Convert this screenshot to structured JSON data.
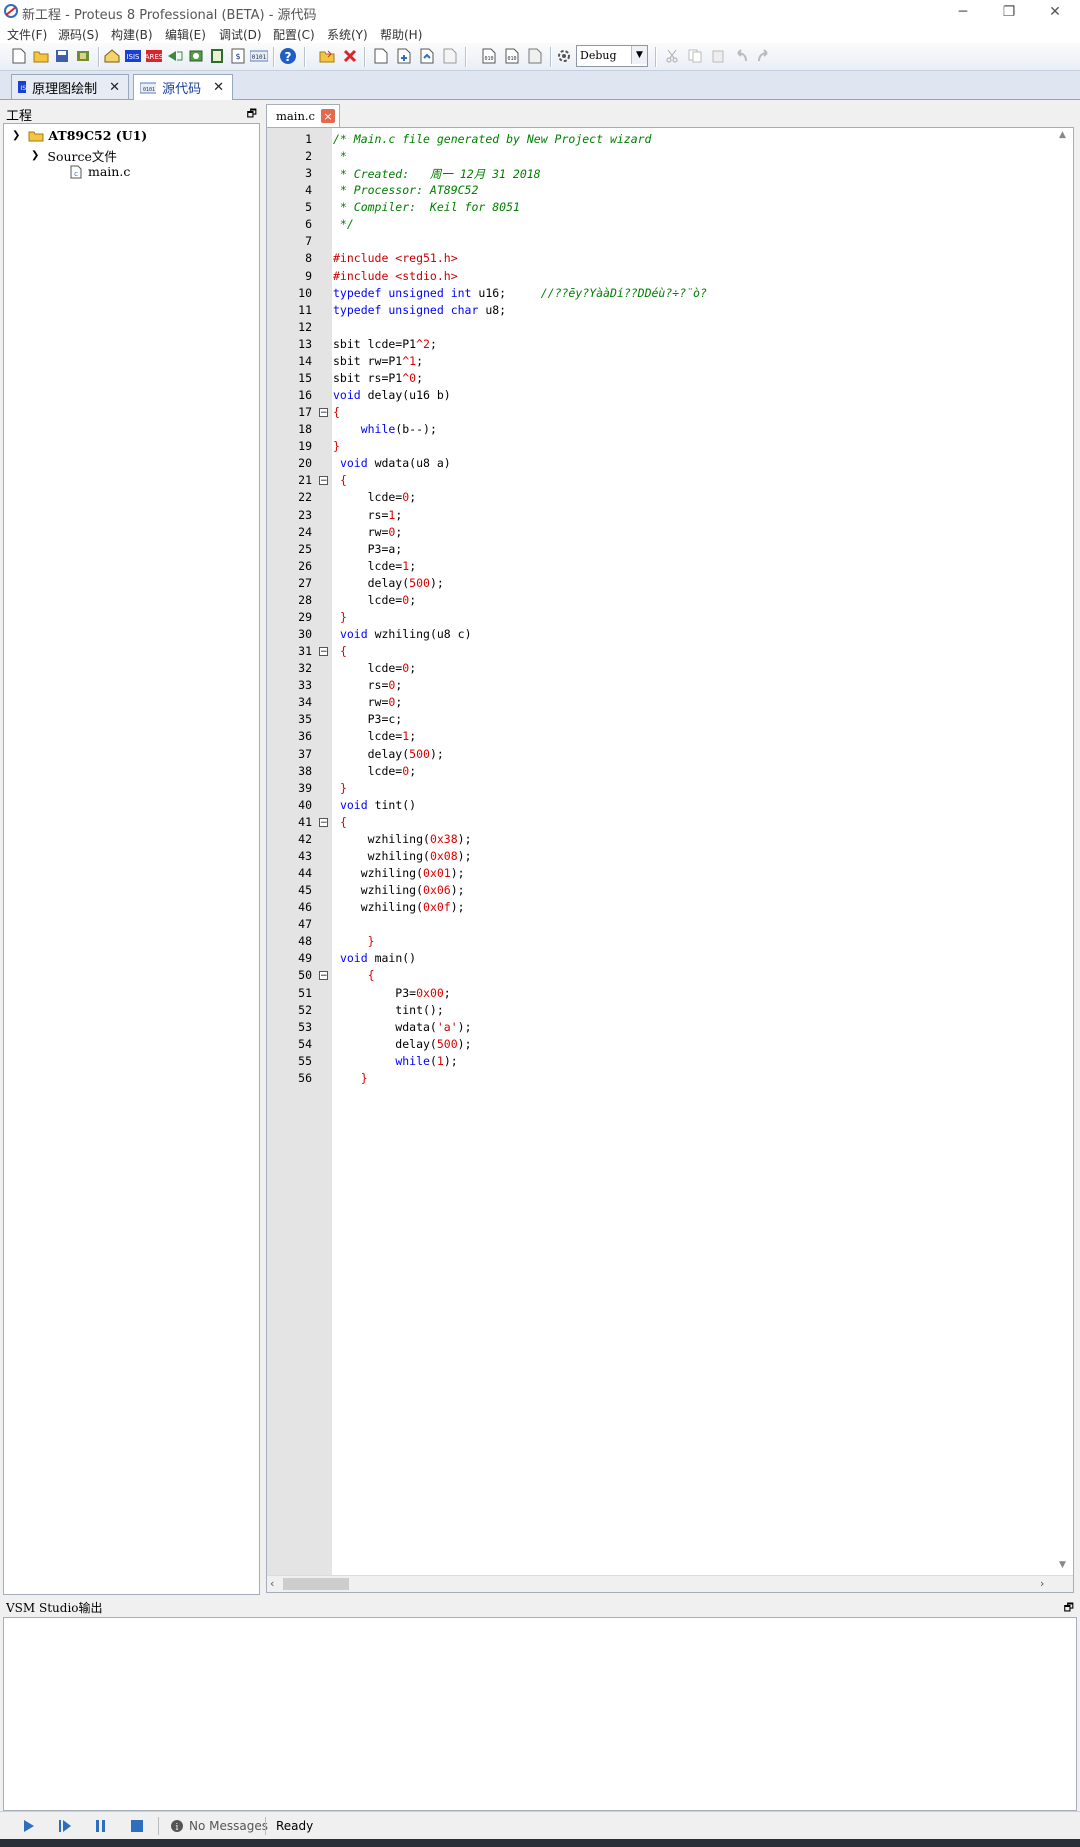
{
  "window": {
    "title": "新工程 - Proteus 8 Professional (BETA) - 源代码",
    "minimize": "─",
    "restore": "❐",
    "close": "✕"
  },
  "menu": [
    "文件(F)",
    "源码(S)",
    "构建(B)",
    "编辑(E)",
    "调试(D)",
    "配置(C)",
    "系统(Y)",
    "帮助(H)"
  ],
  "toolbar": {
    "build_config": "Debug"
  },
  "doc_tabs": [
    {
      "label": "原理图绘制",
      "icon": "schematic-icon",
      "close": "✕"
    },
    {
      "label": "源代码",
      "icon": "source-code-icon",
      "close": "✕"
    }
  ],
  "project": {
    "header": "工程",
    "pin": "🗗",
    "tree": {
      "root": "AT89C52 (U1)",
      "folder": "Source文件",
      "file": "main.c"
    }
  },
  "editor": {
    "tab_label": "main.c",
    "tab_close": "×",
    "lines": [
      [
        [
          "c",
          "/* Main.c file generated by New Project wizard"
        ]
      ],
      [
        [
          "c",
          " *"
        ]
      ],
      [
        [
          "c",
          " * Created:   周一 12月 31 2018"
        ]
      ],
      [
        [
          "c",
          " * Processor: AT89C52"
        ]
      ],
      [
        [
          "c",
          " * Compiler:  Keil for 8051"
        ]
      ],
      [
        [
          "c",
          " */"
        ]
      ],
      [],
      [
        [
          "p",
          "#include <reg51.h>"
        ]
      ],
      [
        [
          "p",
          "#include <stdio.h>"
        ]
      ],
      [
        [
          "k",
          "typedef unsigned int"
        ],
        [
          "t",
          " u16;     "
        ],
        [
          "c",
          "//??ēy?YààDí??DDéù?÷?¨ò?"
        ]
      ],
      [
        [
          "k",
          "typedef unsigned char"
        ],
        [
          "t",
          " u8;"
        ]
      ],
      [],
      [
        [
          "t",
          "sbit lcde=P1"
        ],
        [
          "n",
          "^2"
        ],
        [
          "t",
          ";"
        ]
      ],
      [
        [
          "t",
          "sbit rw=P1"
        ],
        [
          "n",
          "^1"
        ],
        [
          "t",
          ";"
        ]
      ],
      [
        [
          "t",
          "sbit rs=P1"
        ],
        [
          "n",
          "^0"
        ],
        [
          "t",
          ";"
        ]
      ],
      [
        [
          "k",
          "void"
        ],
        [
          "t",
          " delay(u16 b)"
        ]
      ],
      [
        [
          "n",
          "{"
        ]
      ],
      [
        [
          "t",
          "    "
        ],
        [
          "k",
          "while"
        ],
        [
          "t",
          "(b--);"
        ]
      ],
      [
        [
          "n",
          "}"
        ]
      ],
      [
        [
          "t",
          " "
        ],
        [
          "k",
          "void"
        ],
        [
          "t",
          " wdata(u8 a)"
        ]
      ],
      [
        [
          "t",
          " "
        ],
        [
          "n",
          "{"
        ]
      ],
      [
        [
          "t",
          "     lcde="
        ],
        [
          "n",
          "0"
        ],
        [
          "t",
          ";"
        ]
      ],
      [
        [
          "t",
          "     rs="
        ],
        [
          "n",
          "1"
        ],
        [
          "t",
          ";"
        ]
      ],
      [
        [
          "t",
          "     rw="
        ],
        [
          "n",
          "0"
        ],
        [
          "t",
          ";"
        ]
      ],
      [
        [
          "t",
          "     P3=a;"
        ]
      ],
      [
        [
          "t",
          "     lcde="
        ],
        [
          "n",
          "1"
        ],
        [
          "t",
          ";"
        ]
      ],
      [
        [
          "t",
          "     delay("
        ],
        [
          "n",
          "500"
        ],
        [
          "t",
          ");"
        ]
      ],
      [
        [
          "t",
          "     lcde="
        ],
        [
          "n",
          "0"
        ],
        [
          "t",
          ";"
        ]
      ],
      [
        [
          "t",
          " "
        ],
        [
          "n",
          "}"
        ]
      ],
      [
        [
          "t",
          " "
        ],
        [
          "k",
          "void"
        ],
        [
          "t",
          " wzhiling(u8 c)"
        ]
      ],
      [
        [
          "t",
          " "
        ],
        [
          "n",
          "{"
        ]
      ],
      [
        [
          "t",
          "     lcde="
        ],
        [
          "n",
          "0"
        ],
        [
          "t",
          ";"
        ]
      ],
      [
        [
          "t",
          "     rs="
        ],
        [
          "n",
          "0"
        ],
        [
          "t",
          ";"
        ]
      ],
      [
        [
          "t",
          "     rw="
        ],
        [
          "n",
          "0"
        ],
        [
          "t",
          ";"
        ]
      ],
      [
        [
          "t",
          "     P3=c;"
        ]
      ],
      [
        [
          "t",
          "     lcde="
        ],
        [
          "n",
          "1"
        ],
        [
          "t",
          ";"
        ]
      ],
      [
        [
          "t",
          "     delay("
        ],
        [
          "n",
          "500"
        ],
        [
          "t",
          ");"
        ]
      ],
      [
        [
          "t",
          "     lcde="
        ],
        [
          "n",
          "0"
        ],
        [
          "t",
          ";"
        ]
      ],
      [
        [
          "t",
          " "
        ],
        [
          "n",
          "}"
        ]
      ],
      [
        [
          "t",
          " "
        ],
        [
          "k",
          "void"
        ],
        [
          "t",
          " tint()"
        ]
      ],
      [
        [
          "t",
          " "
        ],
        [
          "n",
          "{"
        ]
      ],
      [
        [
          "t",
          "     wzhiling("
        ],
        [
          "n",
          "0x38"
        ],
        [
          "t",
          ");"
        ]
      ],
      [
        [
          "t",
          "     wzhiling("
        ],
        [
          "n",
          "0x08"
        ],
        [
          "t",
          ");"
        ]
      ],
      [
        [
          "t",
          "    wzhiling("
        ],
        [
          "n",
          "0x01"
        ],
        [
          "t",
          ");"
        ]
      ],
      [
        [
          "t",
          "    wzhiling("
        ],
        [
          "n",
          "0x06"
        ],
        [
          "t",
          ");"
        ]
      ],
      [
        [
          "t",
          "    wzhiling("
        ],
        [
          "n",
          "0x0f"
        ],
        [
          "t",
          ");"
        ]
      ],
      [],
      [
        [
          "t",
          "     "
        ],
        [
          "n",
          "}"
        ]
      ],
      [
        [
          "t",
          " "
        ],
        [
          "k",
          "void"
        ],
        [
          "t",
          " main()"
        ]
      ],
      [
        [
          "t",
          "     "
        ],
        [
          "n",
          "{"
        ]
      ],
      [
        [
          "t",
          "         P3="
        ],
        [
          "n",
          "0x00"
        ],
        [
          "t",
          ";"
        ]
      ],
      [
        [
          "t",
          "         tint();"
        ]
      ],
      [
        [
          "t",
          "         wdata("
        ],
        [
          "s",
          "'a'"
        ],
        [
          "t",
          ");"
        ]
      ],
      [
        [
          "t",
          "         delay("
        ],
        [
          "n",
          "500"
        ],
        [
          "t",
          ");"
        ]
      ],
      [
        [
          "t",
          "         "
        ],
        [
          "k",
          "while"
        ],
        [
          "t",
          "("
        ],
        [
          "n",
          "1"
        ],
        [
          "t",
          ");"
        ]
      ],
      [
        [
          "t",
          "    "
        ],
        [
          "n",
          "}"
        ]
      ]
    ],
    "fold_lines": [
      17,
      21,
      31,
      41,
      50
    ],
    "fold_symbol": "−"
  },
  "output": {
    "header": "VSM Studio输出",
    "pin": "🗗"
  },
  "status": {
    "messages": "No Messages",
    "state": "Ready"
  }
}
